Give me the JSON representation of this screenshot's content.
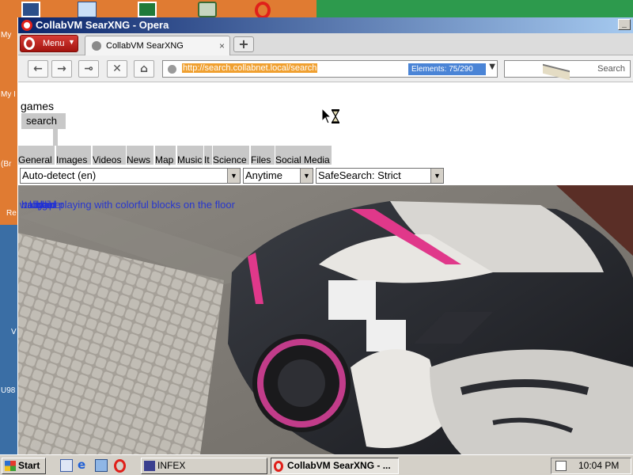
{
  "desktop": {
    "labels": [
      {
        "text": "My"
      },
      {
        "text": "My I"
      },
      {
        "text": "(Br"
      },
      {
        "text": "Re"
      },
      {
        "text": "V"
      },
      {
        "text": "U98"
      }
    ]
  },
  "window": {
    "title": "CollabVM SearXNG - Opera",
    "tab_title": "CollabVM SearXNG",
    "tab_close": "×",
    "new_tab": "+",
    "menu_label": "Menu",
    "url": "http://search.collabnet.local/search",
    "elements_badge": "Elements:   75/290",
    "search_placeholder": "Search"
  },
  "page": {
    "brand": "games",
    "search_button": "search",
    "categories": [
      "General",
      "Images",
      "Videos",
      "News",
      "Map",
      "Music",
      "It",
      "Science",
      "Files",
      "Social Media"
    ],
    "language_select": "Auto-detect (en)",
    "time_select": "Anytime",
    "safesearch_select": "SafeSearch: Strict",
    "overlapping_texts": [
      "wallpaper",
      "baby",
      "kid",
      "child",
      "girl",
      "toddler playing with colorful blocks on the floor"
    ]
  },
  "taskbar": {
    "start_label": "Start",
    "tasks": [
      {
        "label": "INFEX"
      },
      {
        "label": "CollabVM SearXNG - ..."
      }
    ],
    "clock": "10:04 PM"
  }
}
